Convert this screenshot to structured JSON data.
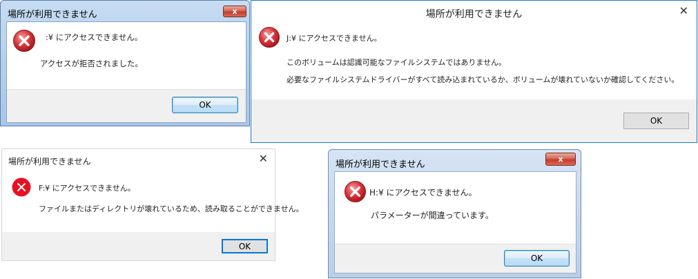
{
  "dialogs": [
    {
      "title": "場所が利用できません",
      "close": "x",
      "message_main": " :¥ にアクセスできません。",
      "message_detail": "アクセスが拒否されました。",
      "ok_label": "OK"
    },
    {
      "title": "場所が利用できません",
      "close": "✕",
      "message_main": "J:¥ にアクセスできません。",
      "message_detail_1": "このボリュームは認識可能なファイルシステムではありません。",
      "message_detail_2": "必要なファイルシステムドライバーがすべて読み込まれているか、ボリュームが壊れていないか確認してください。",
      "ok_label": "OK"
    },
    {
      "title": "場所が利用できません",
      "close": "✕",
      "message_main": "F:¥ にアクセスできません。",
      "message_detail": "ファイルまたはディレクトリが壊れているため、読み取ることができません。",
      "ok_label": "OK"
    },
    {
      "title": "場所が利用できません",
      "close": "x",
      "message_main": "H:¥ にアクセスできません。",
      "message_detail": "パラメーターが間違っています。",
      "ok_label": "OK"
    }
  ],
  "colors": {
    "error_icon_aero": "#c8202a",
    "error_icon_flat": "#e81123",
    "accent": "#0078d7"
  },
  "icons": {
    "error": "error-icon",
    "close": "close-icon"
  }
}
